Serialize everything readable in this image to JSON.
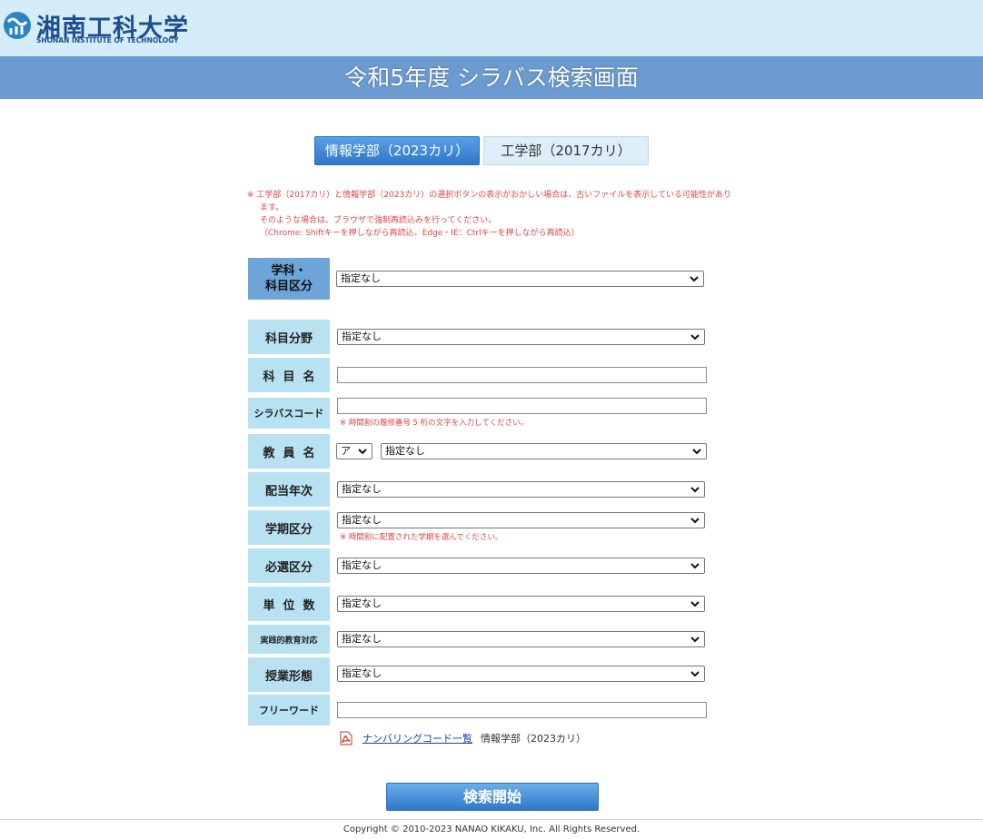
{
  "header": {
    "university_name": "湘南工科大学",
    "university_name_en": "SHONAN INSTITUTE OF TECHNOLOGY",
    "page_title": "令和5年度 シラバス検索画面"
  },
  "tabs": [
    {
      "label": "情報学部（2023カリ）",
      "active": true
    },
    {
      "label": "工学部（2017カリ）",
      "active": false
    }
  ],
  "notice": {
    "line1": "※ 工学部（2017カリ）と情報学部（2023カリ）の選択ボタンの表示がおかしい場合は、古いファイルを表示している可能性があり",
    "line2": "ます。",
    "line3": "そのような場合は、ブラウザで強制再読込みを行ってください。",
    "line4": "（Chrome: Shiftキーを押しながら再読込、Edge・IE：Ctrlキーを押しながら再読込）"
  },
  "form": {
    "department": {
      "label_line1": "学科・",
      "label_line2": "科目区分",
      "value": "指定なし"
    },
    "subject_field": {
      "label": "科目分野",
      "value": "指定なし"
    },
    "subject_name": {
      "label": "科目名",
      "value": ""
    },
    "syllabus_code": {
      "label": "シラバスコード",
      "value": "",
      "hint": "※ 時間割の履修番号 5 桁の文字を入力してください。"
    },
    "instructor": {
      "label": "教員名",
      "kana_value": "ア",
      "value": "指定なし"
    },
    "grade_year": {
      "label": "配当年次",
      "value": "指定なし"
    },
    "semester": {
      "label": "学期区分",
      "value": "指定なし",
      "hint": "※ 時間割に配置された学期を選んでください。"
    },
    "required_elective": {
      "label": "必選区分",
      "value": "指定なし"
    },
    "credits": {
      "label": "単位数",
      "value": "指定なし"
    },
    "practical_education": {
      "label": "実践的教育対応",
      "value": "指定なし"
    },
    "class_format": {
      "label": "授業形態",
      "value": "指定なし"
    },
    "free_word": {
      "label": "フリーワード",
      "value": ""
    }
  },
  "numbering": {
    "link_label": "ナンバリングコード一覧",
    "text": "情報学部（2023カリ）",
    "icon": "pdf-icon"
  },
  "search_button": {
    "label": "検索開始"
  },
  "footer": {
    "copyright": "Copyright © 2010-2023 NANAO KIKAKU, Inc. All Rights Reserved."
  },
  "colors": {
    "header_bg": "#d5edf8",
    "title_bar": "#6b9bd0",
    "label_bg": "#b8e1f2",
    "primary_label_bg": "#6ea5d8",
    "accent": "#2f78c8",
    "notice": "#e04545"
  }
}
